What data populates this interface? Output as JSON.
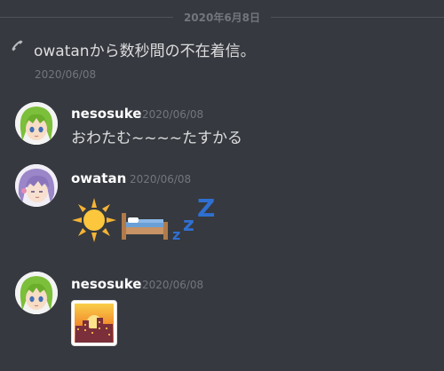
{
  "divider": {
    "date": "2020年6月8日"
  },
  "system_call": {
    "icon": "phone-icon",
    "text": "owatanから数秒間の不在着信。",
    "timestamp": "2020/06/08"
  },
  "messages": [
    {
      "username": "nesosuke",
      "timestamp": "2020/06/08",
      "content": "おわたむ~~~~たすかる",
      "avatar": "green-hair-avatar"
    },
    {
      "username": "owatan",
      "timestamp": "2020/06/08",
      "content": "",
      "emojis": [
        "sun-emoji",
        "bed-emoji",
        "zzz-emoji"
      ],
      "avatar": "purple-hair-avatar"
    },
    {
      "username": "nesosuke",
      "timestamp": "2020/06/08",
      "content": "",
      "emojis": [
        "city-sunset-emoji"
      ],
      "avatar": "green-hair-avatar"
    }
  ],
  "colors": {
    "background": "#36393f",
    "text": "#dcddde",
    "muted": "#72767d",
    "username": "#ffffff"
  }
}
